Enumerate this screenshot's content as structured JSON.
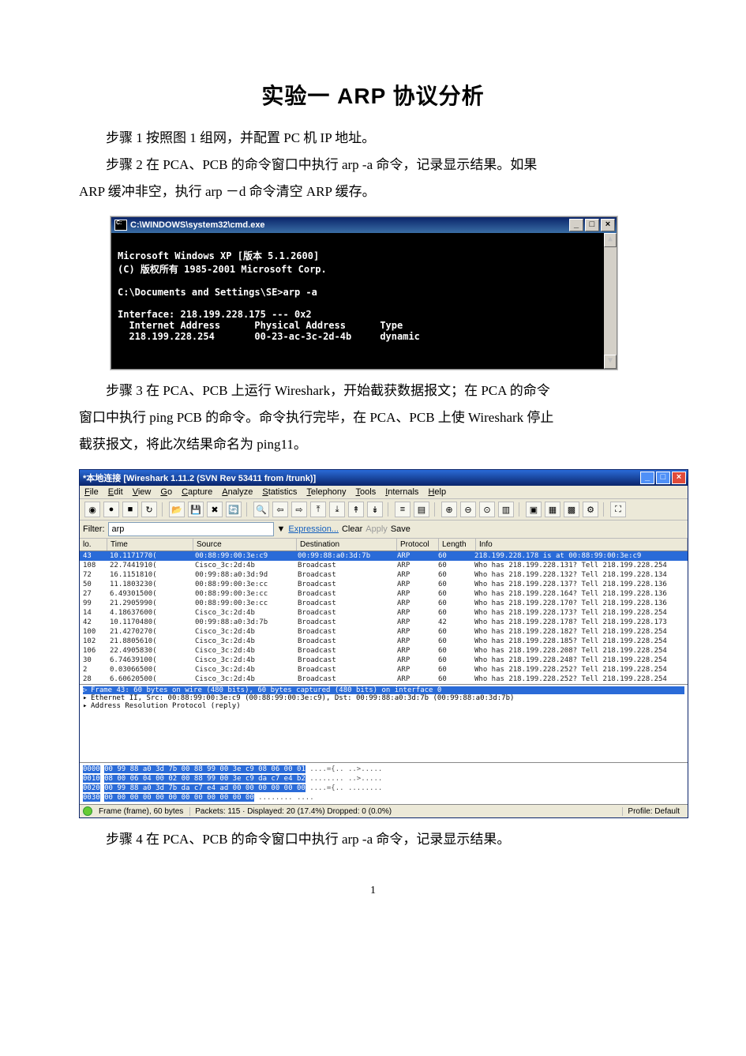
{
  "doc": {
    "title": "实验一 ARP 协议分析",
    "step1": "步骤 1 按照图 1 组网，并配置 PC 机 IP 地址。",
    "step2a": "步骤 2 在 PCA、PCB 的命令窗口中执行 arp -a 命令，记录显示结果。如果",
    "step2b": "ARP 缓冲非空，执行 arp －d 命令清空 ARP 缓存。",
    "step3a": "步骤 3 在 PCA、PCB 上运行 Wireshark，开始截获数据报文；在 PCA 的命令",
    "step3b": "窗口中执行 ping PCB 的命令。命令执行完毕，在 PCA、PCB 上使 Wireshark 停止",
    "step3c": "截获报文，将此次结果命名为 ping11。",
    "step4": "步骤 4 在 PCA、PCB 的命令窗口中执行 arp -a 命令，记录显示结果。",
    "pagenum": "1"
  },
  "cmd": {
    "title": "C:\\WINDOWS\\system32\\cmd.exe",
    "line1": "Microsoft Windows XP [版本 5.1.2600]",
    "line2": "(C) 版权所有 1985-2001 Microsoft Corp.",
    "prompt1": "C:\\Documents and Settings\\SE>arp -a",
    "iface": "Interface: 218.199.228.175 --- 0x2",
    "hdr": "  Internet Address      Physical Address      Type",
    "row": "  218.199.228.254       00-23-ac-3c-2d-4b     dynamic",
    "btn_min": "_",
    "btn_max": "□",
    "btn_close": "×"
  },
  "ws": {
    "title": "*本地连接     [Wireshark 1.11.2   (SVN Rev 53411 from /trunk)]",
    "menus": [
      "File",
      "Edit",
      "View",
      "Go",
      "Capture",
      "Analyze",
      "Statistics",
      "Telephony",
      "Tools",
      "Internals",
      "Help"
    ],
    "filter_label": "Filter:",
    "filter_value": "arp",
    "filter_links": {
      "expr": "Expression...",
      "clear": "Clear",
      "apply": "Apply",
      "save": "Save"
    },
    "cols": {
      "no": "lo.",
      "time": "Time",
      "src": "Source",
      "dst": "Destination",
      "proto": "Protocol",
      "len": "Length",
      "info": "Info"
    },
    "packets": [
      {
        "no": "43",
        "time": "10.1171770(",
        "src": "00:88:99:00:3e:c9",
        "dst": "00:99:88:a0:3d:7b",
        "proto": "ARP",
        "len": "60",
        "info": "218.199.228.178 is at 00:88:99:00:3e:c9",
        "sel": true
      },
      {
        "no": "108",
        "time": "22.7441910(",
        "src": "Cisco_3c:2d:4b",
        "dst": "Broadcast",
        "proto": "ARP",
        "len": "60",
        "info": "Who has 218.199.228.131?  Tell 218.199.228.254"
      },
      {
        "no": "72",
        "time": "16.1151810(",
        "src": "00:99:88:a0:3d:9d",
        "dst": "Broadcast",
        "proto": "ARP",
        "len": "60",
        "info": "Who has 218.199.228.132?  Tell 218.199.228.134"
      },
      {
        "no": "50",
        "time": "11.1803230(",
        "src": "00:88:99:00:3e:cc",
        "dst": "Broadcast",
        "proto": "ARP",
        "len": "60",
        "info": "Who has 218.199.228.137?  Tell 218.199.228.136"
      },
      {
        "no": "27",
        "time": "6.49301500(",
        "src": "00:88:99:00:3e:cc",
        "dst": "Broadcast",
        "proto": "ARP",
        "len": "60",
        "info": "Who has 218.199.228.164?  Tell 218.199.228.136"
      },
      {
        "no": "99",
        "time": "21.2905990(",
        "src": "00:88:99:00:3e:cc",
        "dst": "Broadcast",
        "proto": "ARP",
        "len": "60",
        "info": "Who has 218.199.228.170?  Tell 218.199.228.136"
      },
      {
        "no": "14",
        "time": "4.18637600(",
        "src": "Cisco_3c:2d:4b",
        "dst": "Broadcast",
        "proto": "ARP",
        "len": "60",
        "info": "Who has 218.199.228.173?  Tell 218.199.228.254"
      },
      {
        "no": "42",
        "time": "10.1170480(",
        "src": "00:99:88:a0:3d:7b",
        "dst": "Broadcast",
        "proto": "ARP",
        "len": "42",
        "info": "Who has 218.199.228.178?  Tell 218.199.228.173"
      },
      {
        "no": "100",
        "time": "21.4270270(",
        "src": "Cisco_3c:2d:4b",
        "dst": "Broadcast",
        "proto": "ARP",
        "len": "60",
        "info": "Who has 218.199.228.182?  Tell 218.199.228.254"
      },
      {
        "no": "102",
        "time": "21.8805610(",
        "src": "Cisco_3c:2d:4b",
        "dst": "Broadcast",
        "proto": "ARP",
        "len": "60",
        "info": "Who has 218.199.228.185?  Tell 218.199.228.254"
      },
      {
        "no": "106",
        "time": "22.4905830(",
        "src": "Cisco_3c:2d:4b",
        "dst": "Broadcast",
        "proto": "ARP",
        "len": "60",
        "info": "Who has 218.199.228.208?  Tell 218.199.228.254"
      },
      {
        "no": "30",
        "time": "6.74639100(",
        "src": "Cisco_3c:2d:4b",
        "dst": "Broadcast",
        "proto": "ARP",
        "len": "60",
        "info": "Who has 218.199.228.248?  Tell 218.199.228.254"
      },
      {
        "no": "2",
        "time": "0.03066500(",
        "src": "Cisco_3c:2d:4b",
        "dst": "Broadcast",
        "proto": "ARP",
        "len": "60",
        "info": "Who has 218.199.228.252?  Tell 218.199.228.254"
      },
      {
        "no": "28",
        "time": "6.60620500(",
        "src": "Cisco_3c:2d:4b",
        "dst": "Broadcast",
        "proto": "ARP",
        "len": "60",
        "info": "Who has 218.199.228.252?  Tell 218.199.228.254"
      }
    ],
    "detail": {
      "frame": "Frame 43: 60 bytes on wire (480 bits), 60 bytes captured (480 bits) on interface 0",
      "eth": "Ethernet II, Src: 00:88:99:00:3e:c9 (00:88:99:00:3e:c9), Dst: 00:99:88:a0:3d:7b (00:99:88:a0:3d:7b)",
      "arp": "Address Resolution Protocol (reply)"
    },
    "hex_off": [
      "0000",
      "0010",
      "0020",
      "0030"
    ],
    "hex_rows": [
      "00 99 88 a0 3d 7b 00 88  99 00 3e c9 08 06 00 01",
      "08 00 06 04 00 02 00 88  99 00 3e c9 da c7 e4 b2",
      "00 99 88 a0 3d 7b da c7  e4 ad 00 00 00 00 00 00",
      "00 00 00 00 00 00 00 00  00 00 00 00"
    ],
    "hex_ascii": [
      "....={.. ..>.....",
      "........ ..>.....",
      "....={.. ........",
      "........ ...."
    ],
    "status": {
      "left": "Frame (frame), 60 bytes",
      "center": "Packets: 115 · Displayed: 20 (17.4%)     Dropped: 0 (0.0%)",
      "right": "Profile: Default"
    },
    "toolbar_icons": [
      "circle",
      "record",
      "stop",
      "restart",
      "open",
      "save",
      "close",
      "reload",
      "search",
      "back",
      "fwd",
      "rewind",
      "goend",
      "go1",
      "go2",
      "list1",
      "list2",
      "zoomin",
      "zoomout",
      "zoomreset",
      "cols",
      "color1",
      "color2",
      "color3",
      "settings",
      "help"
    ]
  }
}
